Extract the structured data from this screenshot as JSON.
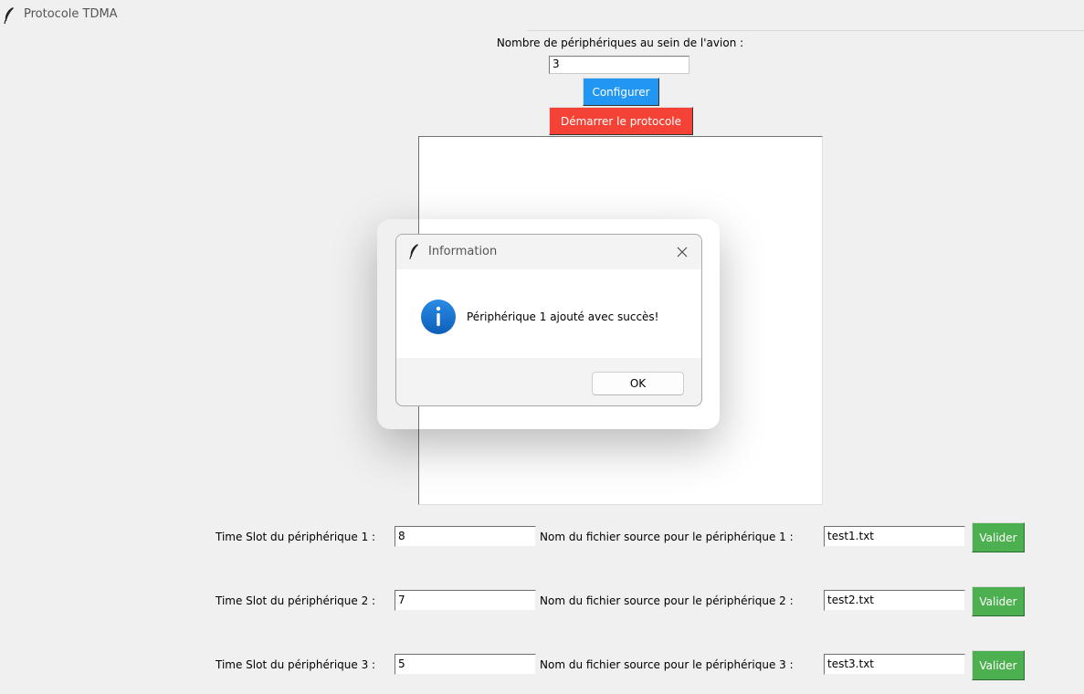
{
  "window": {
    "title": "Protocole TDMA"
  },
  "config": {
    "count_label": "Nombre de périphériques au sein de l'avion :",
    "count_value": "3",
    "configure_label": "Configurer",
    "start_label": "Démarrer le protocole"
  },
  "devices": [
    {
      "slot_label": "Time Slot du périphérique 1 :",
      "slot_value": "8",
      "file_label": "Nom du fichier source pour le périphérique 1 :",
      "file_value": "test1.txt",
      "validate_label": "Valider"
    },
    {
      "slot_label": "Time Slot du périphérique 2 :",
      "slot_value": "7",
      "file_label": "Nom du fichier source pour le périphérique 2 :",
      "file_value": "test2.txt",
      "validate_label": "Valider"
    },
    {
      "slot_label": "Time Slot du périphérique 3 :",
      "slot_value": "5",
      "file_label": "Nom du fichier source pour le périphérique 3 :",
      "file_value": "test3.txt",
      "validate_label": "Valider"
    }
  ],
  "dialog": {
    "title": "Information",
    "message": "Périphérique 1 ajouté avec succès!",
    "ok_label": "OK",
    "icon": "info-icon"
  },
  "colors": {
    "configure": "#2196f3",
    "start": "#f44336",
    "validate": "#4caf50",
    "info": "#1976d2"
  }
}
